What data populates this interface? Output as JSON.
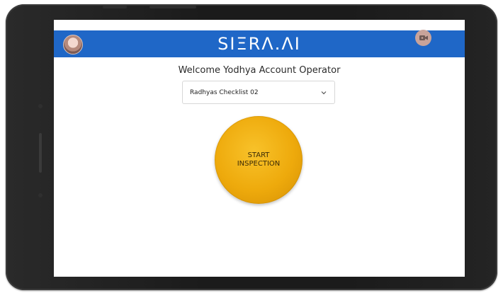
{
  "app": {
    "brand": "SIΞRΛ.ΛI",
    "welcome": "Welcome Yodhya Account Operator"
  },
  "checklist_select": {
    "selected": "Radhyas Checklist 02"
  },
  "start_button": {
    "line1": "START",
    "line2": "INSPECTION"
  },
  "icons": {
    "avatar": "user-avatar",
    "camera": "video-camera-icon",
    "chevron": "chevron-down-icon"
  },
  "colors": {
    "appbar": "#1f67c7",
    "start_button": "#eeaa0c",
    "camera_button": "#c9a39a"
  }
}
